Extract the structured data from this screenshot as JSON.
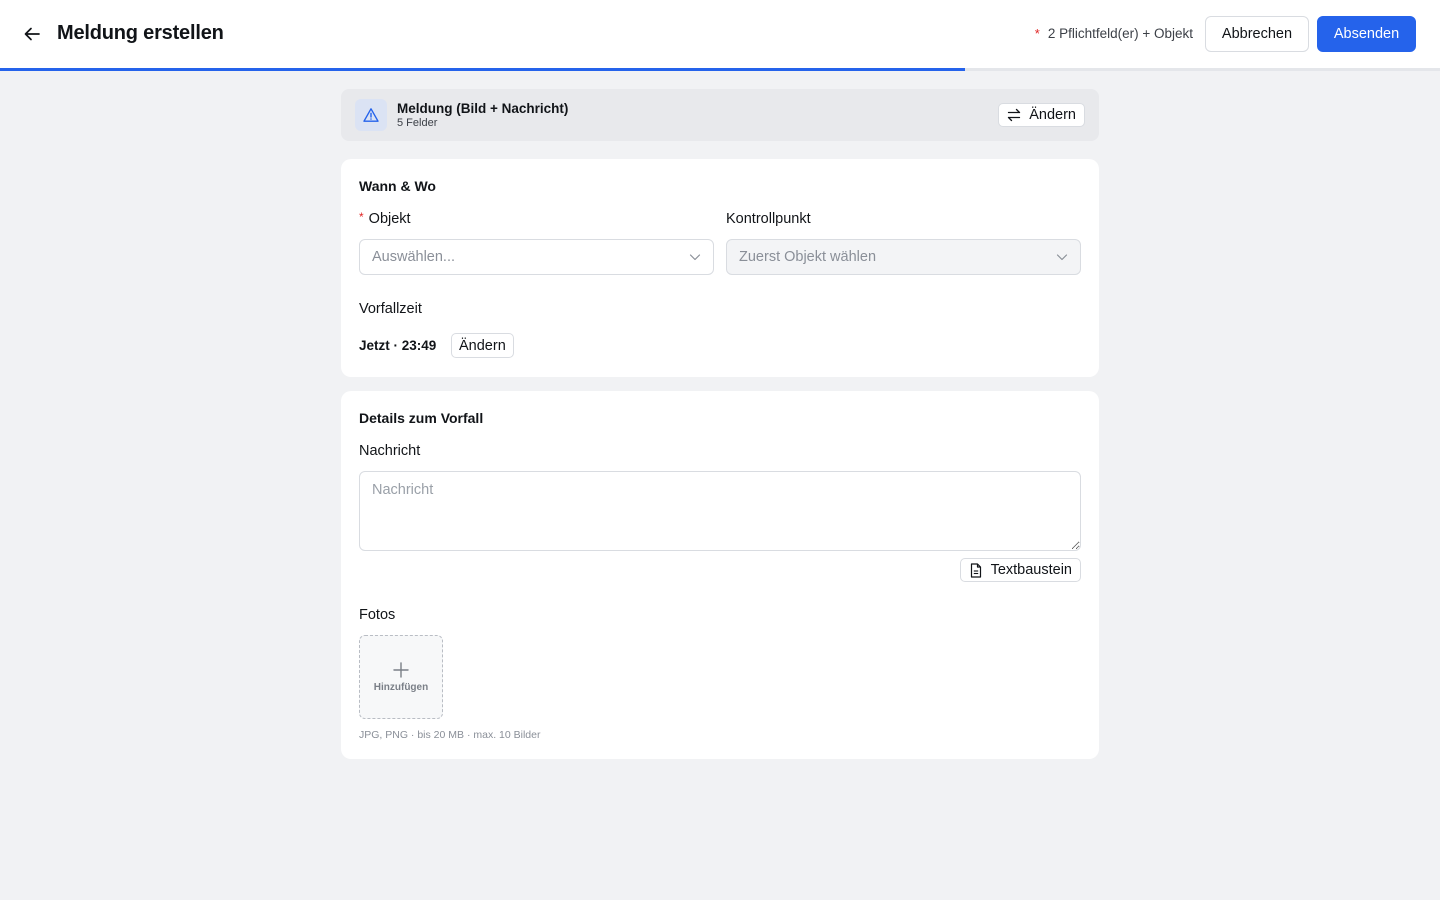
{
  "header": {
    "title": "Meldung erstellen",
    "required_hint": "2 Pflichtfeld(er) + Objekt",
    "cancel_label": "Abbrechen",
    "submit_label": "Absenden",
    "progress_fraction": 0.67
  },
  "report_type": {
    "title": "Meldung (Bild + Nachricht)",
    "subtitle": "5 Felder",
    "change_label": "Ändern",
    "icon": "warning-triangle-icon"
  },
  "when_where": {
    "section_title": "Wann & Wo",
    "object": {
      "label": "Objekt",
      "required": true,
      "placeholder": "Auswählen..."
    },
    "checkpoint": {
      "label": "Kontrollpunkt",
      "placeholder": "Zuerst Objekt wählen",
      "disabled": true
    },
    "incident_time": {
      "label": "Vorfallzeit",
      "value": "Jetzt · 23:49",
      "change_label": "Ändern"
    }
  },
  "details": {
    "section_title": "Details zum Vorfall",
    "message": {
      "label": "Nachricht",
      "placeholder": "Nachricht",
      "value": ""
    },
    "snippet_label": "Textbaustein",
    "photos": {
      "label": "Fotos",
      "add_label": "Hinzufügen",
      "hint": "JPG, PNG · bis 20 MB · max. 10 Bilder"
    }
  },
  "colors": {
    "accent": "#2563eb",
    "required_star": "#e02424",
    "background": "#f1f2f4"
  }
}
